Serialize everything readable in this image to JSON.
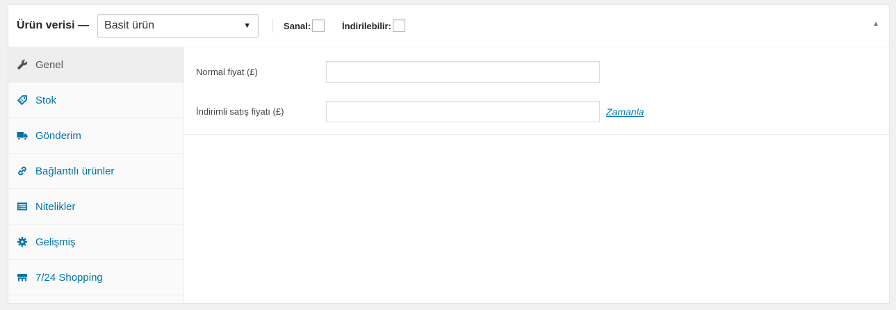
{
  "header": {
    "title": "Ürün verisi —",
    "product_type": "Basit ürün",
    "virtual_label": "Sanal:",
    "downloadable_label": "İndirilebilir:",
    "toggle_icon": "triangle-up"
  },
  "tabs": [
    {
      "label": "Genel",
      "icon": "wrench-icon",
      "active": true
    },
    {
      "label": "Stok",
      "icon": "tag-icon",
      "active": false
    },
    {
      "label": "Gönderim",
      "icon": "truck-icon",
      "active": false
    },
    {
      "label": "Bağlantılı ürünler",
      "icon": "link-icon",
      "active": false
    },
    {
      "label": "Nitelikler",
      "icon": "list-card-icon",
      "active": false
    },
    {
      "label": "Gelişmiş",
      "icon": "gear-icon",
      "active": false
    },
    {
      "label": "7/24 Shopping",
      "icon": "storefront-icon",
      "active": false
    }
  ],
  "general": {
    "regular_price_label": "Normal fiyat (£)",
    "regular_price_value": "",
    "sale_price_label": "İndirimli satış fiyatı (£)",
    "sale_price_value": "",
    "schedule_link": "Zamanla"
  },
  "colors": {
    "link": "#0073aa",
    "active_tab_bg": "#eeeeee",
    "tabs_bg": "#fafafa"
  }
}
